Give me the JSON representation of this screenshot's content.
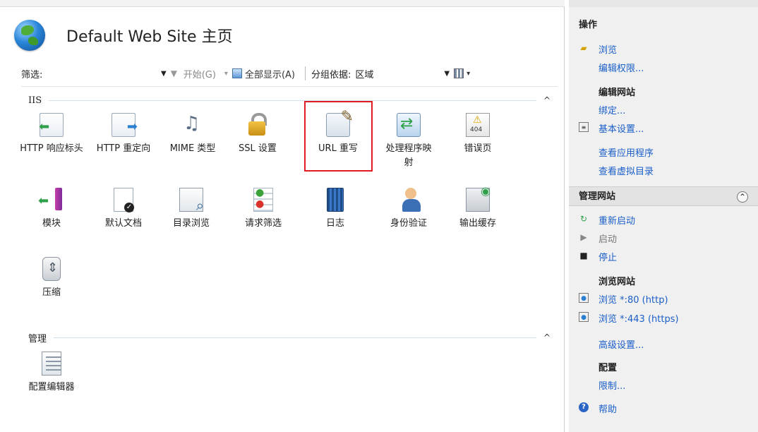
{
  "header": {
    "title": "Default Web Site 主页"
  },
  "toolbar": {
    "filter_label": "筛选:",
    "filter_value": "",
    "start_label": "开始(G)",
    "show_all_label": "全部显示(A)",
    "group_by_label": "分组依据:",
    "group_by_value": "区域"
  },
  "sections": {
    "iis": {
      "title": "IIS"
    },
    "manage": {
      "title": "管理"
    }
  },
  "features": {
    "http_response_headers": "HTTP 响应标头",
    "http_redirect": "HTTP 重定向",
    "mime_types": "MIME 类型",
    "ssl_settings": "SSL 设置",
    "url_rewrite": "URL 重写",
    "handler_mappings": "处理程序映射",
    "error_pages": "错误页",
    "modules": "模块",
    "default_document": "默认文档",
    "directory_browsing": "目录浏览",
    "request_filtering": "请求筛选",
    "logging": "日志",
    "authentication": "身份验证",
    "output_caching": "输出缓存",
    "compression": "压缩",
    "config_editor": "配置编辑器"
  },
  "actions": {
    "title": "操作",
    "browse": "浏览",
    "edit_permissions": "编辑权限...",
    "edit_site_title": "编辑网站",
    "bindings": "绑定...",
    "basic_settings": "基本设置...",
    "view_applications": "查看应用程序",
    "view_virtual_dirs": "查看虚拟目录",
    "manage_site_title": "管理网站",
    "restart": "重新启动",
    "start": "启动",
    "stop": "停止",
    "browse_site_title": "浏览网站",
    "browse_80": "浏览 *:80 (http)",
    "browse_443": "浏览 *:443 (https)",
    "advanced_settings": "高级设置...",
    "config_title": "配置",
    "limits": "限制...",
    "help": "帮助"
  },
  "colors": {
    "link": "#1a5ec9",
    "highlight": "#e11b22"
  }
}
